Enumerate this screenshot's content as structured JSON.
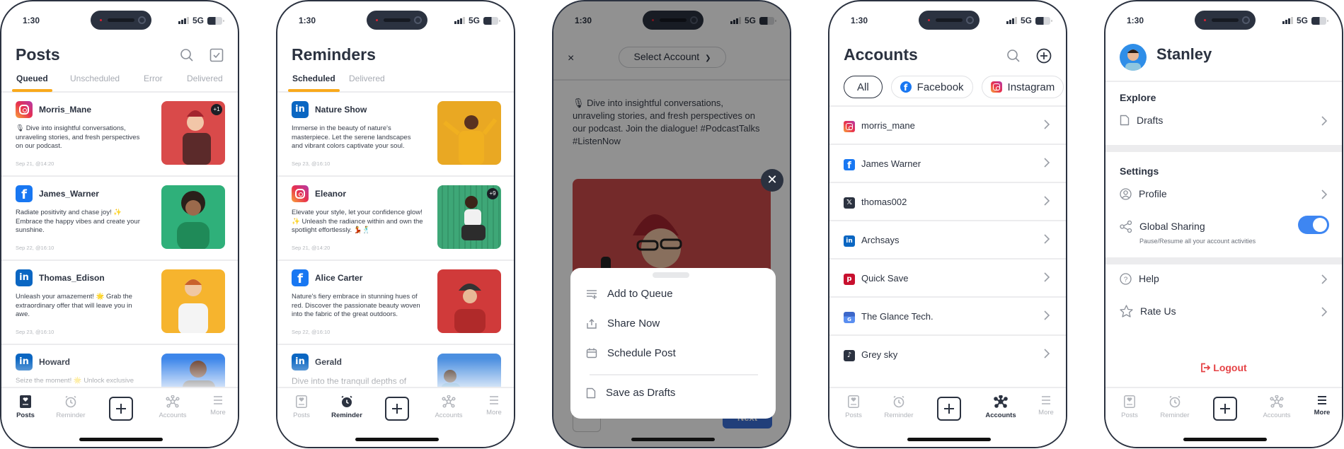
{
  "status_bar": {
    "time": "1:30",
    "network": "5G"
  },
  "colors": {
    "accent": "#f9a91b",
    "brand_blue": "#3e86f2",
    "danger": "#e54346",
    "text": "#2b3240"
  },
  "tabbar": {
    "posts": "Posts",
    "reminder": "Reminder",
    "accounts": "Accounts",
    "more": "More"
  },
  "posts_screen": {
    "title": "Posts",
    "tabs": [
      "Queued",
      "Unscheduled",
      "Error",
      "Delivered"
    ],
    "active_tab": "Queued",
    "items": [
      {
        "network": "instagram",
        "user": "Morris_Mane",
        "text": "🎙 Dive into insightful conversations, unraveling stories, and fresh perspectives on our podcast.",
        "date": "Sep 21, @14:20",
        "badge": "+1",
        "thumb_color": "#d94a4a"
      },
      {
        "network": "facebook",
        "user": "James_Warner",
        "text": "Radiate positivity and chase joy! ✨ Embrace the happy vibes and create your sunshine.",
        "date": "Sep 22, @16:10",
        "thumb_color": "#2fb07a"
      },
      {
        "network": "linkedin",
        "user": "Thomas_Edison",
        "text": "Unleash your amazement! 🌟 Grab the extraordinary offer that will leave you in awe.",
        "date": "Sep 23, @16:10",
        "thumb_color": "#f6b42e"
      },
      {
        "network": "linkedin",
        "user": "Howard",
        "text": "Seize the moment! 🌟 Unlock exclusive",
        "date": "",
        "thumb_color": "#3d86ea"
      }
    ]
  },
  "reminders_screen": {
    "title": "Reminders",
    "tabs": [
      "Scheduled",
      "Delivered"
    ],
    "active_tab": "Scheduled",
    "items": [
      {
        "network": "linkedin",
        "user": "Nature Show",
        "text": "Immerse in the beauty of nature's masterpiece. Let the serene landscapes and vibrant colors captivate your soul.",
        "date": "Sep 23, @16:10",
        "thumb_color": "#e9a823"
      },
      {
        "network": "instagram",
        "user": "Eleanor",
        "text": "Elevate your style, let your confidence glow! ✨ Unleash the radiance within and own the spotlight effortlessly. 💃🕺",
        "date": "Sep 21, @14:20",
        "badge": "+9",
        "thumb_color": "#3ea777"
      },
      {
        "network": "facebook",
        "user": "Alice Carter",
        "text": "Nature's fiery embrace in stunning hues of red. Discover the passionate beauty woven into the fabric of the great outdoors.",
        "date": "Sep 22, @16:10",
        "thumb_color": "#d03a3a"
      },
      {
        "network": "linkedin",
        "user": "Gerald",
        "text": "Dive into the tranquil depths of",
        "date": "",
        "thumb_color": "#4b8fe0"
      }
    ]
  },
  "compose_screen": {
    "close": "×",
    "select_account": "Select Account",
    "text": "🎙 Dive into insightful conversations, unraveling stories, and fresh perspectives on our podcast. Join the dialogue! #PodcastTalks #ListenNow",
    "next": "Next",
    "sheet_items": [
      "Add to Queue",
      "Share Now",
      "Schedule Post",
      "Save as Drafts"
    ]
  },
  "accounts_screen": {
    "title": "Accounts",
    "filters": [
      "All",
      "Facebook",
      "Instagram"
    ],
    "active_filter": "All",
    "accounts": [
      {
        "network": "instagram",
        "name": "morris_mane"
      },
      {
        "network": "facebook",
        "name": "James Warner"
      },
      {
        "network": "x",
        "name": "thomas002"
      },
      {
        "network": "linkedin",
        "name": "Archsays"
      },
      {
        "network": "pinterest",
        "name": "Quick Save"
      },
      {
        "network": "google-business",
        "name": "The Glance Tech."
      },
      {
        "network": "tiktok",
        "name": "Grey sky"
      }
    ]
  },
  "more_screen": {
    "user_name": "Stanley",
    "explore_heading": "Explore",
    "drafts": "Drafts",
    "settings_heading": "Settings",
    "profile": "Profile",
    "global_sharing": "Global Sharing",
    "global_sharing_sub": "Pause/Resume all your account activities",
    "global_sharing_on": true,
    "help": "Help",
    "rate_us": "Rate Us",
    "logout": "Logout"
  }
}
